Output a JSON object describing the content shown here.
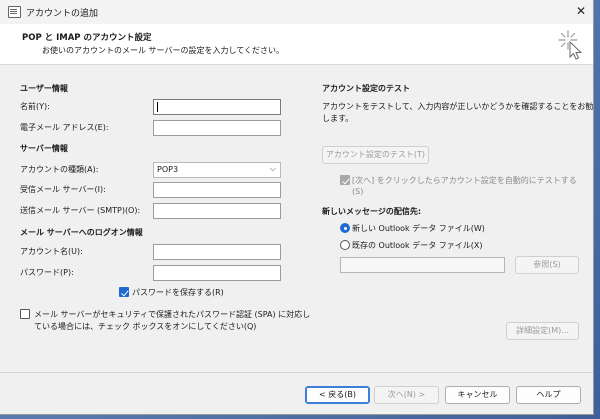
{
  "window": {
    "title": "アカウントの追加",
    "close_glyph": "✕"
  },
  "header": {
    "title": "POP と IMAP のアカウント設定",
    "subtitle": "お使いのアカウントのメール サーバーの設定を入力してください。"
  },
  "user_info": {
    "heading": "ユーザー情報",
    "name_label": "名前(Y):",
    "name_value": "",
    "email_label": "電子メール アドレス(E):",
    "email_value": ""
  },
  "server_info": {
    "heading": "サーバー情報",
    "account_type_label": "アカウントの種類(A):",
    "account_type_value": "POP3",
    "incoming_label": "受信メール サーバー(I):",
    "incoming_value": "",
    "outgoing_label": "送信メール サーバー (SMTP)(O):",
    "outgoing_value": ""
  },
  "logon_info": {
    "heading": "メール サーバーへのログオン情報",
    "account_name_label": "アカウント名(U):",
    "account_name_value": "",
    "password_label": "パスワード(P):",
    "password_value": "",
    "remember_password_label": "パスワードを保存する(R)",
    "remember_password_checked": true,
    "spa_line1": "メール サーバーがセキュリティで保護されたパスワード認証 (SPA) に対応し",
    "spa_line2": "ている場合には、チェック ボックスをオンにしてください(Q)",
    "spa_checked": false
  },
  "test": {
    "heading": "アカウント設定のテスト",
    "desc_line1": "アカウントをテストして、入力内容が正しいかどうかを確認することをお勧め",
    "desc_line2": "します。",
    "test_button": "アカウント設定のテスト(T)",
    "auto_test_line1": "[次へ] をクリックしたらアカウント設定を自動的にテストする",
    "auto_test_line2": "(S)",
    "auto_test_checked": true
  },
  "delivery": {
    "heading": "新しいメッセージの配信先:",
    "new_file_label": "新しい Outlook データ ファイル(W)",
    "existing_file_label": "既存の Outlook データ ファイル(X)",
    "selected": "new",
    "path_value": "",
    "browse_button": "参照(S)"
  },
  "more_settings_button": "詳細設定(M)...",
  "footer": {
    "back": "< 戻る(B)",
    "next": "次へ(N) >",
    "cancel": "キャンセル",
    "help": "ヘルプ"
  },
  "colors": {
    "accent": "#1e6ad4",
    "window_bg": "#f0f0f0",
    "header_bg": "#ffffff"
  }
}
